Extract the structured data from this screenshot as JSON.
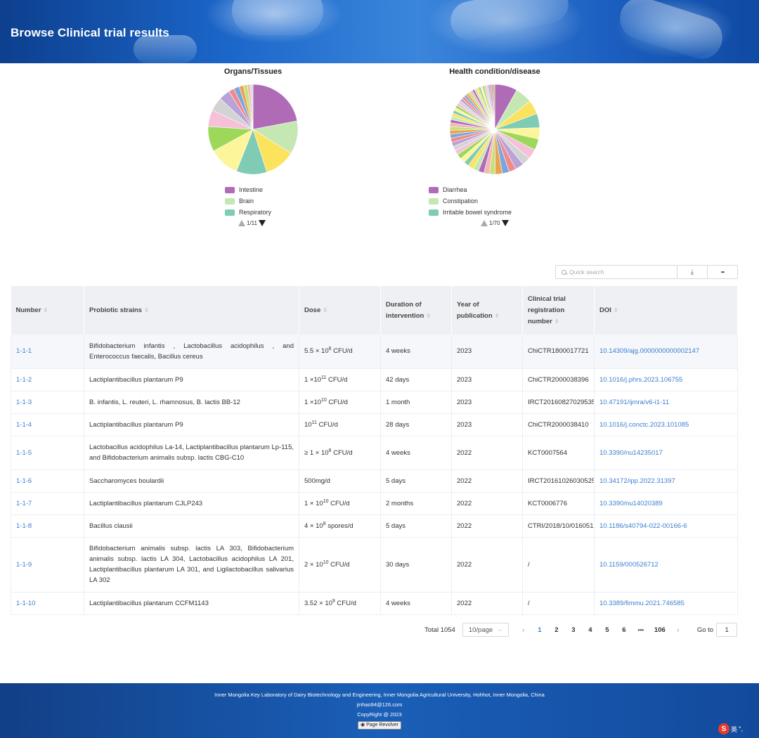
{
  "page": {
    "title": "Browse Clinical trial results"
  },
  "charts": [
    {
      "title": "Organs/Tissues",
      "legend": [
        {
          "label": "Intestine",
          "color": "#b06bb7"
        },
        {
          "label": "Brain",
          "color": "#c5e8b2"
        },
        {
          "label": "Respiratory",
          "color": "#7fcbb3"
        }
      ],
      "pager": "1/11"
    },
    {
      "title": "Health condition/disease",
      "legend": [
        {
          "label": "Diarrhea",
          "color": "#b06bb7"
        },
        {
          "label": "Constipation",
          "color": "#c5e8b2"
        },
        {
          "label": "Irritable bowel syndrome",
          "color": "#7fcbb3"
        }
      ],
      "pager": "1/70"
    }
  ],
  "chart_data": [
    {
      "type": "pie",
      "title": "Organs/Tissues",
      "labels": [
        "Intestine",
        "Brain",
        "Respiratory"
      ],
      "values": [
        22,
        12,
        11,
        11,
        11,
        9,
        6,
        5,
        4,
        2,
        2,
        1.5,
        1.5,
        1,
        1
      ],
      "colors": [
        "#b06bb7",
        "#c5e8b2",
        "#fbe35d",
        "#7fcbb3",
        "#fdf59a",
        "#9ed85a",
        "#f6c0d9",
        "#d3d3d3",
        "#b8a2d8",
        "#f08a8a",
        "#7aa6e0",
        "#e9a44f",
        "#c6e07a",
        "#f4b6b6",
        "#dcdcdc"
      ]
    },
    {
      "type": "pie",
      "title": "Health condition/disease",
      "labels": [
        "Diarrhea",
        "Constipation",
        "Irritable bowel syndrome"
      ],
      "values": [
        8,
        6,
        5,
        5,
        4,
        4,
        3.5,
        3,
        3,
        2.5,
        2.5,
        2.5,
        2,
        2,
        2,
        2,
        2,
        1.8,
        1.8,
        1.8,
        1.6,
        1.6,
        1.5,
        1.5,
        1.4,
        1.4,
        1.3,
        1.3,
        1.2,
        1.2,
        1.1,
        1.1,
        1,
        1,
        1,
        1,
        1,
        1,
        0.9,
        0.9,
        0.9,
        0.8,
        0.8,
        0.8,
        0.8,
        0.7,
        0.7,
        0.7,
        0.7,
        0.6,
        0.6,
        0.6,
        0.6,
        0.6
      ],
      "colors": [
        "#b06bb7",
        "#c5e8b2",
        "#fbe35d",
        "#7fcbb3",
        "#fdf59a",
        "#9ed85a",
        "#f6c0d9",
        "#d3d3d3",
        "#b8a2d8",
        "#f08a8a",
        "#7aa6e0",
        "#e9a44f",
        "#c6e07a",
        "#f4b6b6"
      ]
    }
  ],
  "toolbar": {
    "search_placeholder": "Quick search",
    "download_icon": "download-icon",
    "grid_icon": "grid-icon"
  },
  "table": {
    "columns": [
      "Number",
      "Probiotic strains",
      "Dose",
      "Duration of intervention",
      "Year of publication",
      "Clinical trial registration number",
      "DOI"
    ],
    "rows": [
      {
        "number": "1-1-1",
        "strains": "Bifidobacterium infantis , Lactobacillus acidophilus , and Enterococcus faecalis, Bacillus cereus",
        "dose_pre": "5.5 × 10",
        "dose_sup": "6",
        "dose_post": " CFU/d",
        "duration": "4 weeks",
        "year": "2023",
        "reg": "ChiCTR1800017721",
        "doi": "10.14309/ajg.0000000000002147"
      },
      {
        "number": "1-1-2",
        "strains": "Lactiplantibacillus plantarum P9",
        "dose_pre": "1 ×10",
        "dose_sup": "11",
        "dose_post": " CFU/d",
        "duration": "42 days",
        "year": "2023",
        "reg": "ChiCTR2000038396",
        "doi": "10.1016/j.phrs.2023.106755"
      },
      {
        "number": "1-1-3",
        "strains": "B. infantis, L. reuteri, L. rhamnosus, B. lactis BB-12",
        "dose_pre": "1 ×10",
        "dose_sup": "10",
        "dose_post": " CFU/d",
        "duration": "1 month",
        "year": "2023",
        "reg": "IRCT20160827029535",
        "doi": "10.47191/ijmra/v6-i1-11"
      },
      {
        "number": "1-1-4",
        "strains": "Lactiplantibacillus plantarum P9",
        "dose_pre": "10",
        "dose_sup": "11",
        "dose_post": " CFU/d",
        "duration": "28 days",
        "year": "2023",
        "reg": "ChiCTR2000038410",
        "doi": "10.1016/j.conctc.2023.101085"
      },
      {
        "number": "1-1-5",
        "strains": "Lactobacillus acidophilus La-14, Lactiplantibacillus plantarum Lp-115, and Bifidobacterium animalis subsp. lactis CBG-C10",
        "dose_pre": "≥ 1 × 10",
        "dose_sup": "8",
        "dose_post": " CFU/d",
        "duration": "4 weeks",
        "year": "2022",
        "reg": "KCT0007564",
        "doi": "10.3390/nu14235017"
      },
      {
        "number": "1-1-6",
        "strains": "Saccharomyces boulardii",
        "dose_pre": "500mg/d",
        "dose_sup": "",
        "dose_post": "",
        "duration": "5 days",
        "year": "2022",
        "reg": "IRCT20161026030525",
        "doi": "10.34172/ipp.2022.31397"
      },
      {
        "number": "1-1-7",
        "strains": "Lactiplantibacillus plantarum CJLP243",
        "dose_pre": "1 × 10",
        "dose_sup": "10",
        "dose_post": " CFU/d",
        "duration": "2 months",
        "year": "2022",
        "reg": "KCT0006776",
        "doi": "10.3390/nu14020389"
      },
      {
        "number": "1-1-8",
        "strains": "Bacillus clausii",
        "dose_pre": "4 × 10",
        "dose_sup": "8",
        "dose_post": "  spores/d",
        "duration": "5 days",
        "year": "2022",
        "reg": "CTRI/2018/10/016051",
        "doi": "10.1186/s40794-022-00166-6"
      },
      {
        "number": "1-1-9",
        "strains": "Bifidobacterium animalis subsp. lactis LA 303, Bifidobacterium animalis subsp. lactis LA 304, Lactobacillus acidophilus LA 201, Lactiplantibacillus plantarum LA 301, and Ligilactobacillus salivarius LA 302",
        "dose_pre": "2 × 10",
        "dose_sup": "10",
        "dose_post": " CFU/d",
        "duration": "30 days",
        "year": "2022",
        "reg": "/",
        "doi": "10.1159/000526712"
      },
      {
        "number": "1-1-10",
        "strains": "Lactiplantibacillus plantarum CCFM1143",
        "dose_pre": "3.52 × 10",
        "dose_sup": "9",
        "dose_post": " CFU/d",
        "duration": "4 weeks",
        "year": "2022",
        "reg": "/",
        "doi": "10.3389/fimmu.2021.746585"
      }
    ]
  },
  "pagination": {
    "total": "Total 1054",
    "page_size": "10/page",
    "pages": [
      "1",
      "2",
      "3",
      "4",
      "5",
      "6",
      "•••",
      "106"
    ],
    "current": "1",
    "goto_label": "Go to",
    "goto_value": "1"
  },
  "footer": {
    "line1": "Inner Mongolia Key Laboratory of Dairy Biotechnology and Engineering, Inner Mongolia Agricultural University, Hohhot, Inner Mongolia, China",
    "email": "jinhao94@126.com",
    "copyright": "CopyRight @ 2023",
    "badge": "Page Revolver"
  },
  "ime": {
    "label": "英"
  }
}
